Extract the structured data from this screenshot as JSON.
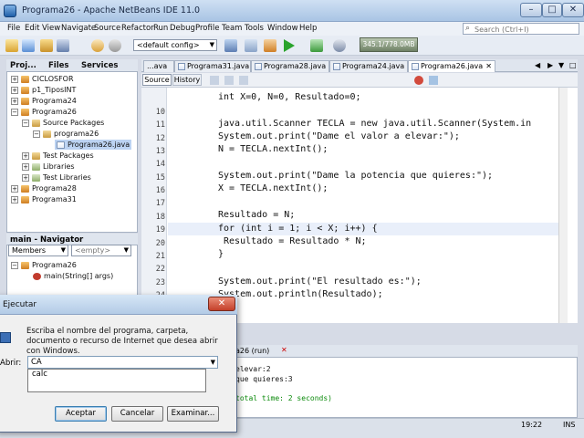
{
  "window": {
    "title": "Programa26 - Apache NetBeans IDE 11.0"
  },
  "menu": [
    "File",
    "Edit",
    "View",
    "Navigate",
    "Source",
    "Refactor",
    "Run",
    "Debug",
    "Profile",
    "Team",
    "Tools",
    "Window",
    "Help"
  ],
  "search": {
    "placeholder": "Search (Ctrl+I)"
  },
  "toolbar": {
    "config": "<default config>",
    "memory": "345.1/778.0MB"
  },
  "projects": {
    "tabs": [
      "Proj...",
      "Files",
      "Services"
    ],
    "tree": [
      "CICLOSFOR",
      "p1_TiposINT",
      "Programa24",
      "Programa26",
      "Source Packages",
      "programa26",
      "Programa26.java",
      "Test Packages",
      "Libraries",
      "Test Libraries",
      "Programa28",
      "Programa31"
    ]
  },
  "navigator": {
    "title": "main - Navigator",
    "members": "Members",
    "filter": "<empty>",
    "class": "Programa26",
    "method": "main(String[] args)"
  },
  "editor": {
    "tabs": [
      "...ava",
      "Programa31.java",
      "Programa28.java",
      "Programa24.java",
      "Programa26.java"
    ],
    "source_label": "Source",
    "history_label": "History",
    "line_numbers": [
      "10",
      "11",
      "12",
      "13",
      "14",
      "15",
      "16",
      "17",
      "18",
      "19",
      "20",
      "21",
      "22",
      "23",
      "24"
    ],
    "lines": [
      "int X=0, N=0, Resultado=0;",
      "",
      "java.util.Scanner TECLA = new java.util.Scanner(System.in",
      "System.out.print(\"Dame el valor a elevar:\");",
      "N = TECLA.nextInt();",
      "",
      "System.out.print(\"Dame la potencia que quieres:\");",
      "X = TECLA.nextInt();",
      "",
      "Resultado = N;",
      "for (int i = 1; i < X; i++) {",
      " Resultado = Resultado * N;",
      "}",
      "",
      "System.out.print(\"El resultado es:\");",
      "System.out.println(Resultado);"
    ]
  },
  "output": {
    "tab": "a26 (run)",
    "lines": [
      "elevar:2",
      "que quieres:3",
      "",
      "total time: 2 seconds)"
    ]
  },
  "status": {
    "position": "19:22",
    "mode": "INS"
  },
  "run_dialog": {
    "title": "Ejecutar",
    "description": "Escriba el nombre del programa, carpeta, documento o recurso de Internet que desea abrir con Windows.",
    "field_label": "Abrir:",
    "input_value": "CA",
    "suggestion": "calc",
    "accept": "Aceptar",
    "cancel": "Cancelar",
    "browse": "Examinar..."
  }
}
